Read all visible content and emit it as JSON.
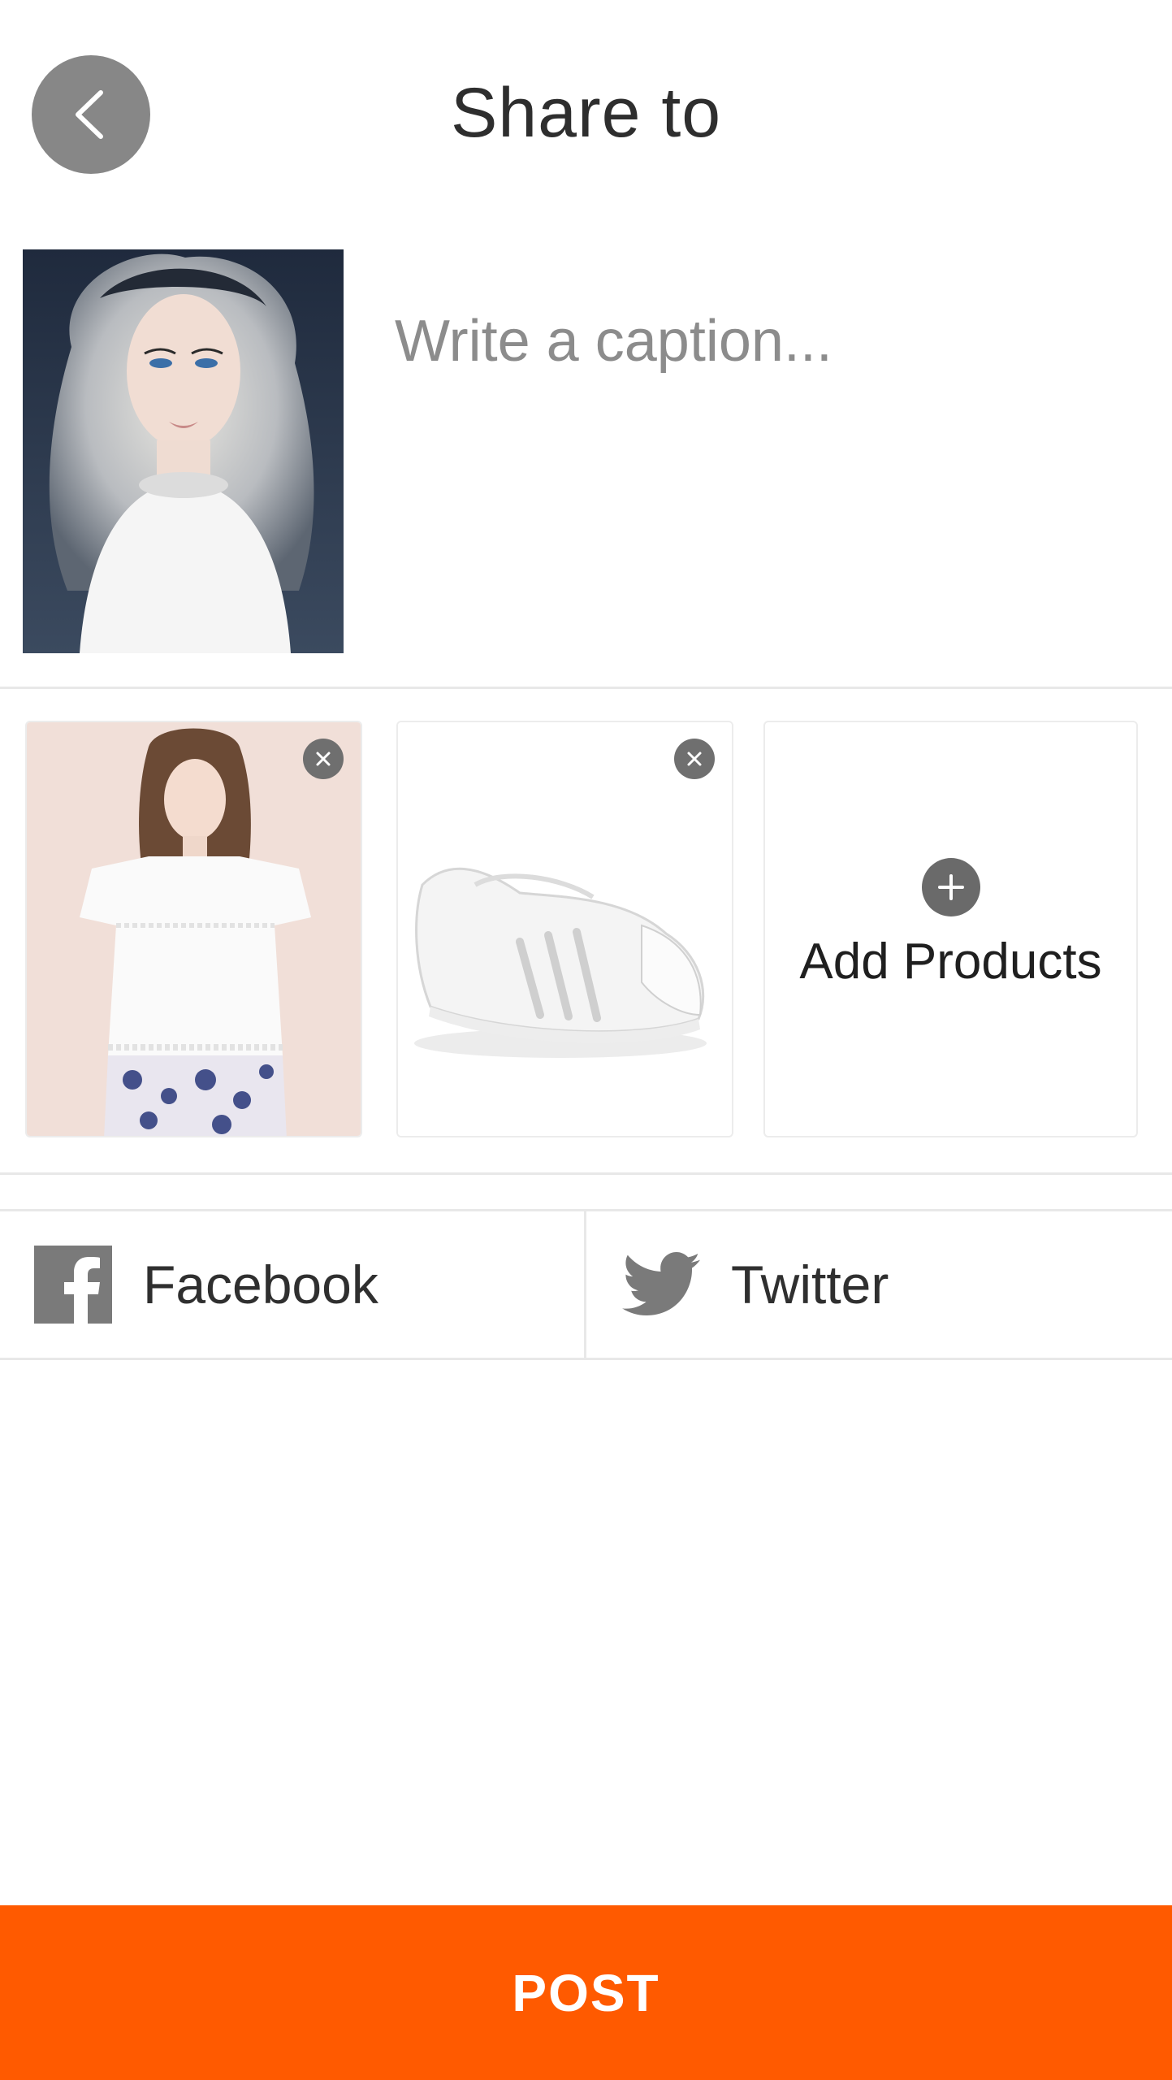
{
  "header": {
    "title": "Share to",
    "back_icon": "chevron-left-icon"
  },
  "composer": {
    "photo_alt": "Portrait photo",
    "caption_placeholder": "Write a caption...",
    "caption_value": ""
  },
  "products": {
    "items": [
      {
        "name": "White lace blouse with floral skirt",
        "remove_icon": "close-icon"
      },
      {
        "name": "White sneaker",
        "remove_icon": "close-icon"
      }
    ],
    "add_label": "Add Products",
    "add_icon": "plus-circle-icon"
  },
  "share": {
    "facebook_label": "Facebook",
    "facebook_icon": "facebook-icon",
    "twitter_label": "Twitter",
    "twitter_icon": "twitter-icon"
  },
  "post": {
    "label": "POST",
    "color": "#ff5a00"
  }
}
